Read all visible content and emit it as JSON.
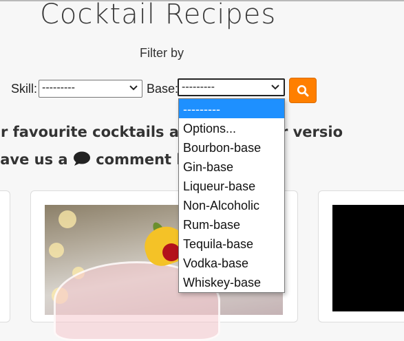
{
  "header": {
    "title": "Cocktail Recipes"
  },
  "filters": {
    "label": "Filter by",
    "skill_label": "Skill:",
    "skill_value": "---------",
    "base_label": "Base:",
    "base_value": "---------"
  },
  "dropdown": {
    "options": [
      "---------",
      "Options...",
      "Bourbon-base",
      "Gin-base",
      "Liqueur-base",
      "Non-Alcoholic",
      "Rum-base",
      "Tequila-base",
      "Vodka-base",
      "Whiskey-base"
    ],
    "selected_index": 0
  },
  "intro": {
    "line1": "ur favourite cocktails a c                   Tipsy Tiger versio",
    "line2_before": "eave us a",
    "line2_after": "comment let                   thoughts."
  },
  "icons": {
    "search": "search-icon",
    "comment": "comment-icon"
  },
  "colors": {
    "accent": "#ff7f00",
    "selected": "#1e90ff"
  }
}
